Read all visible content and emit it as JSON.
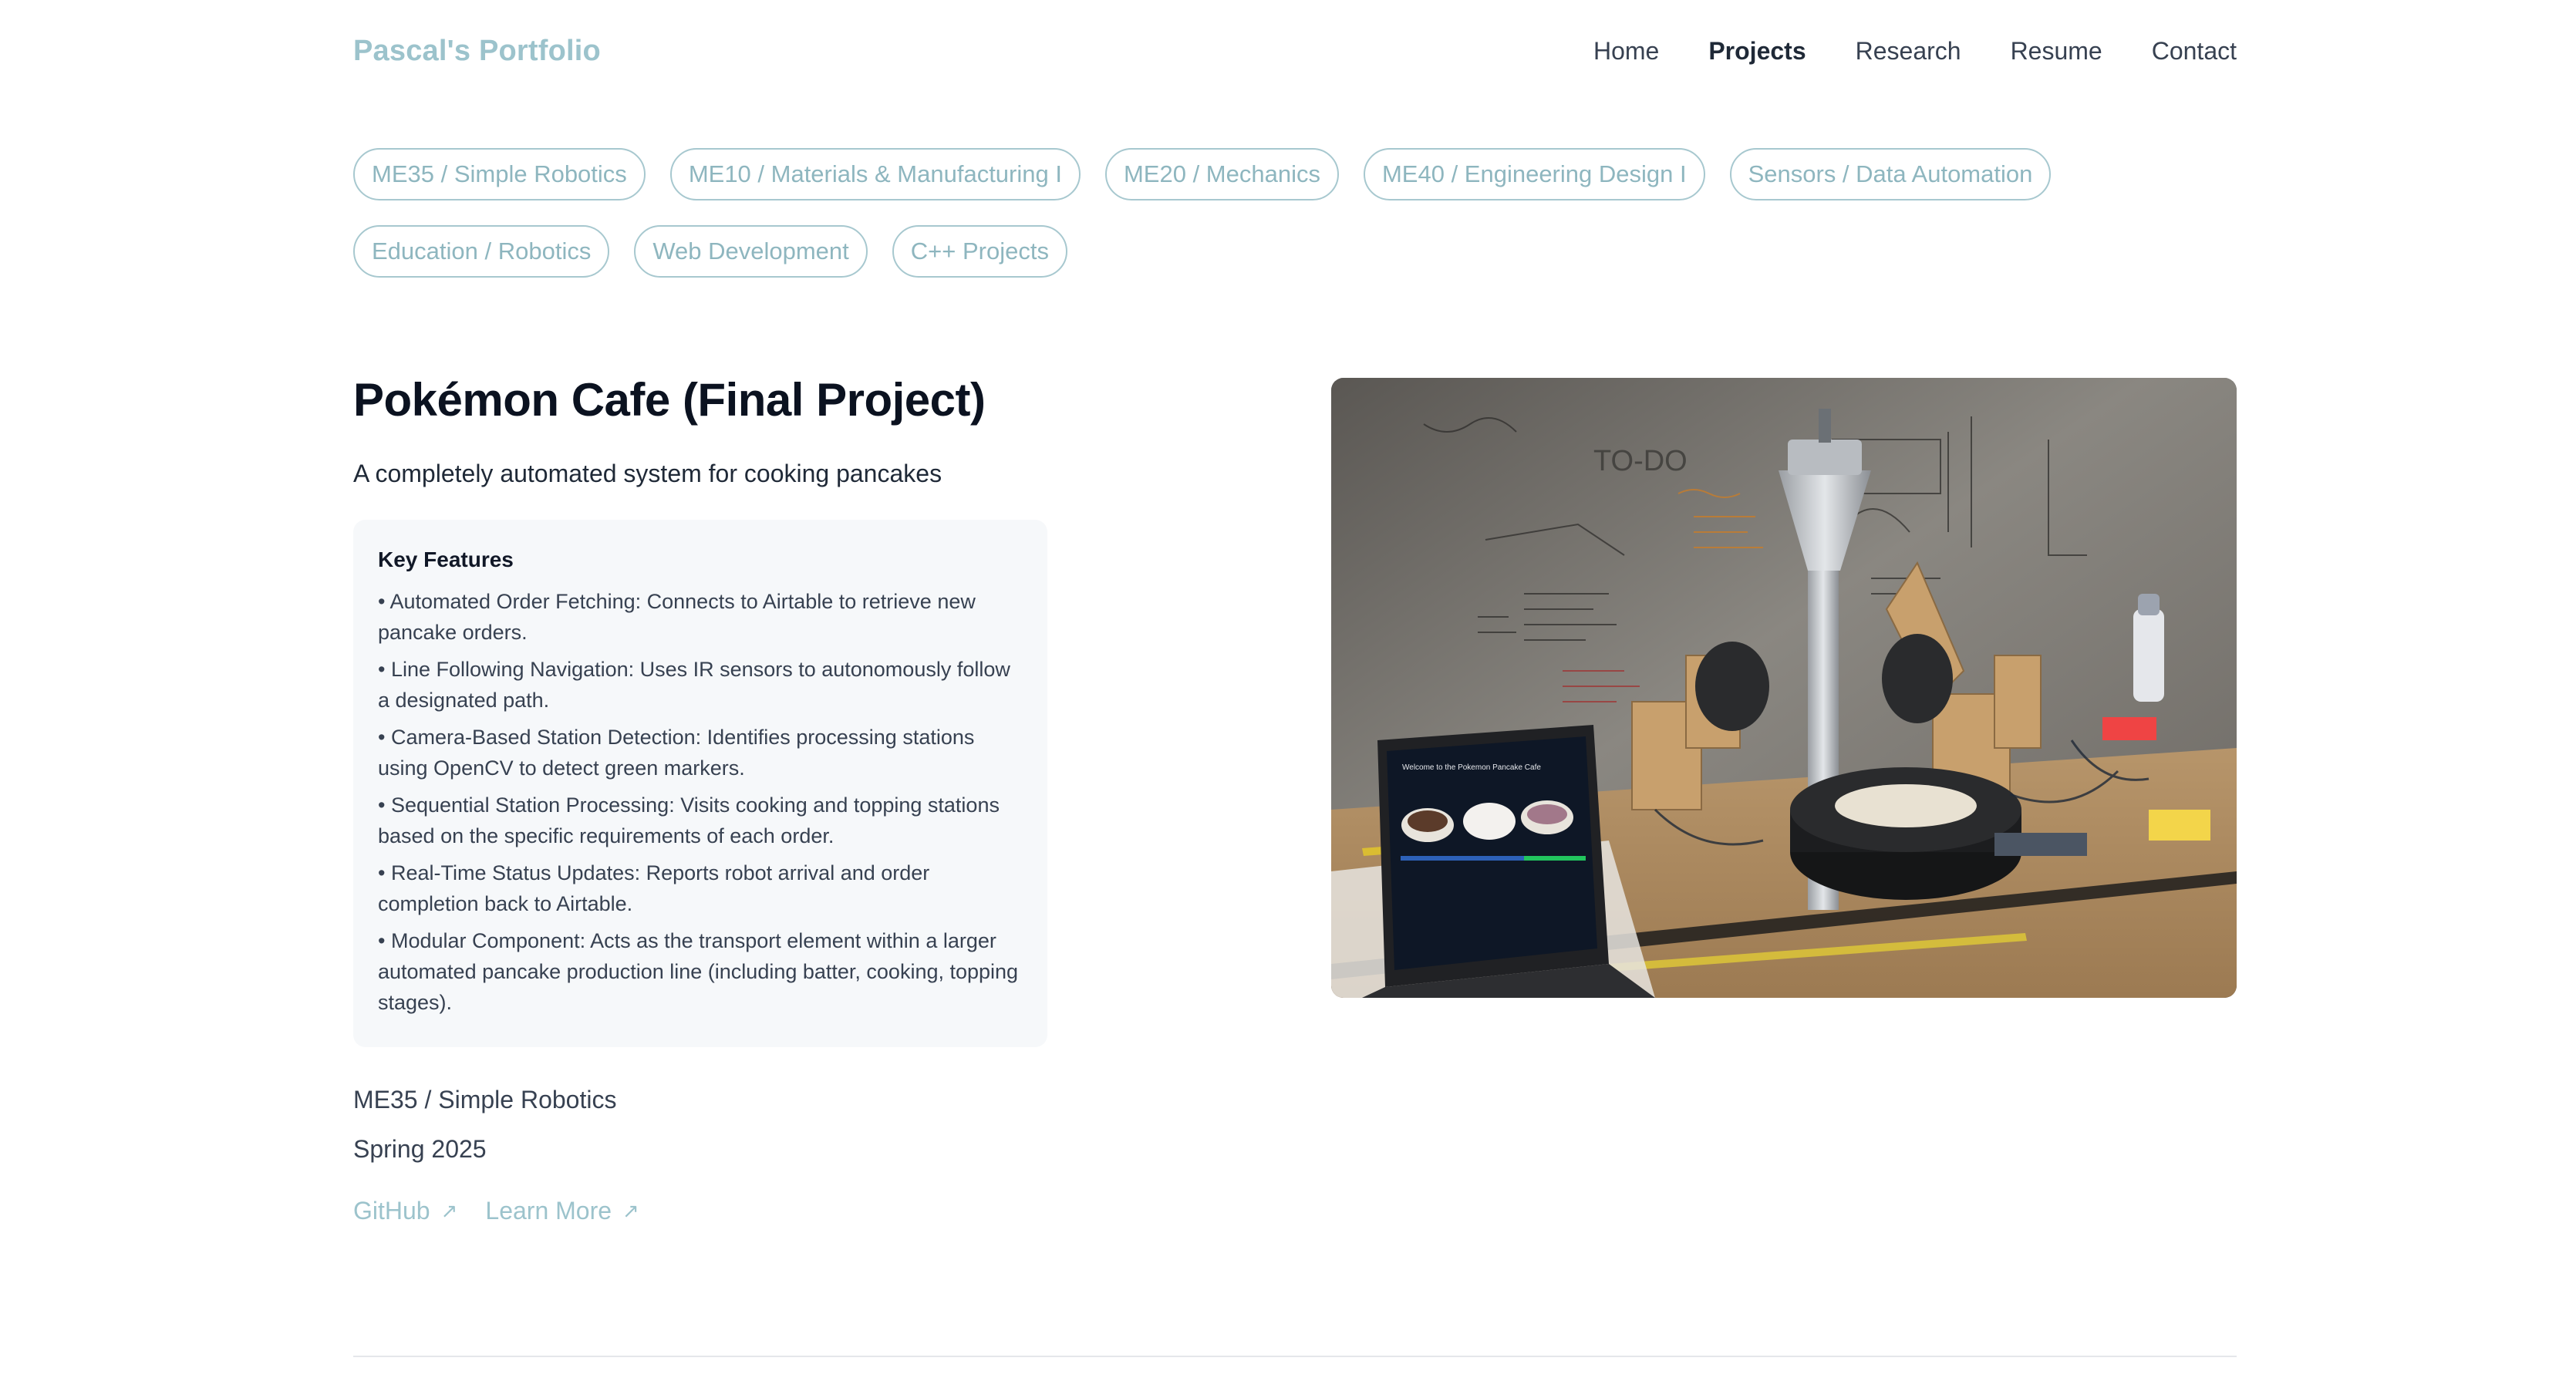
{
  "header": {
    "brand": "Pascal's Portfolio",
    "nav": [
      {
        "label": "Home",
        "active": false
      },
      {
        "label": "Projects",
        "active": true
      },
      {
        "label": "Research",
        "active": false
      },
      {
        "label": "Resume",
        "active": false
      },
      {
        "label": "Contact",
        "active": false
      }
    ]
  },
  "categories": [
    "ME35 / Simple Robotics",
    "ME10 / Materials & Manufacturing I",
    "ME20 / Mechanics",
    "ME40 / Engineering Design I",
    "Sensors / Data Automation",
    "Education / Robotics",
    "Web Development",
    "C++ Projects"
  ],
  "project": {
    "title": "Pokémon Cafe (Final Project)",
    "subtitle": "A completely automated system for cooking pancakes",
    "features_heading": "Key Features",
    "features": [
      "Automated Order Fetching: Connects to Airtable to retrieve new pancake orders.",
      "Line Following Navigation: Uses IR sensors to autonomously follow a designated path.",
      "Camera-Based Station Detection: Identifies processing stations using OpenCV to detect green markers.",
      "Sequential Station Processing: Visits cooking and topping stations based on the specific requirements of each order.",
      "Real-Time Status Updates: Reports robot arrival and order completion back to Airtable.",
      "Modular Component: Acts as the transport element within a larger automated pancake production line (including batter, cooking, topping stages)."
    ],
    "course": "ME35 / Simple Robotics",
    "term": "Spring 2025",
    "links": {
      "github": "GitHub",
      "learn_more": "Learn More",
      "arrow": "↗"
    },
    "photo": {
      "whiteboard_heading": "TO-DO",
      "laptop_screen": "Welcome to the Pokemon Pancake Cafe"
    }
  },
  "colors": {
    "accent": "#9cc3cc",
    "chip_border": "#a7c8cf",
    "text": "#1f2937",
    "panel_bg": "#f6f8fa"
  }
}
